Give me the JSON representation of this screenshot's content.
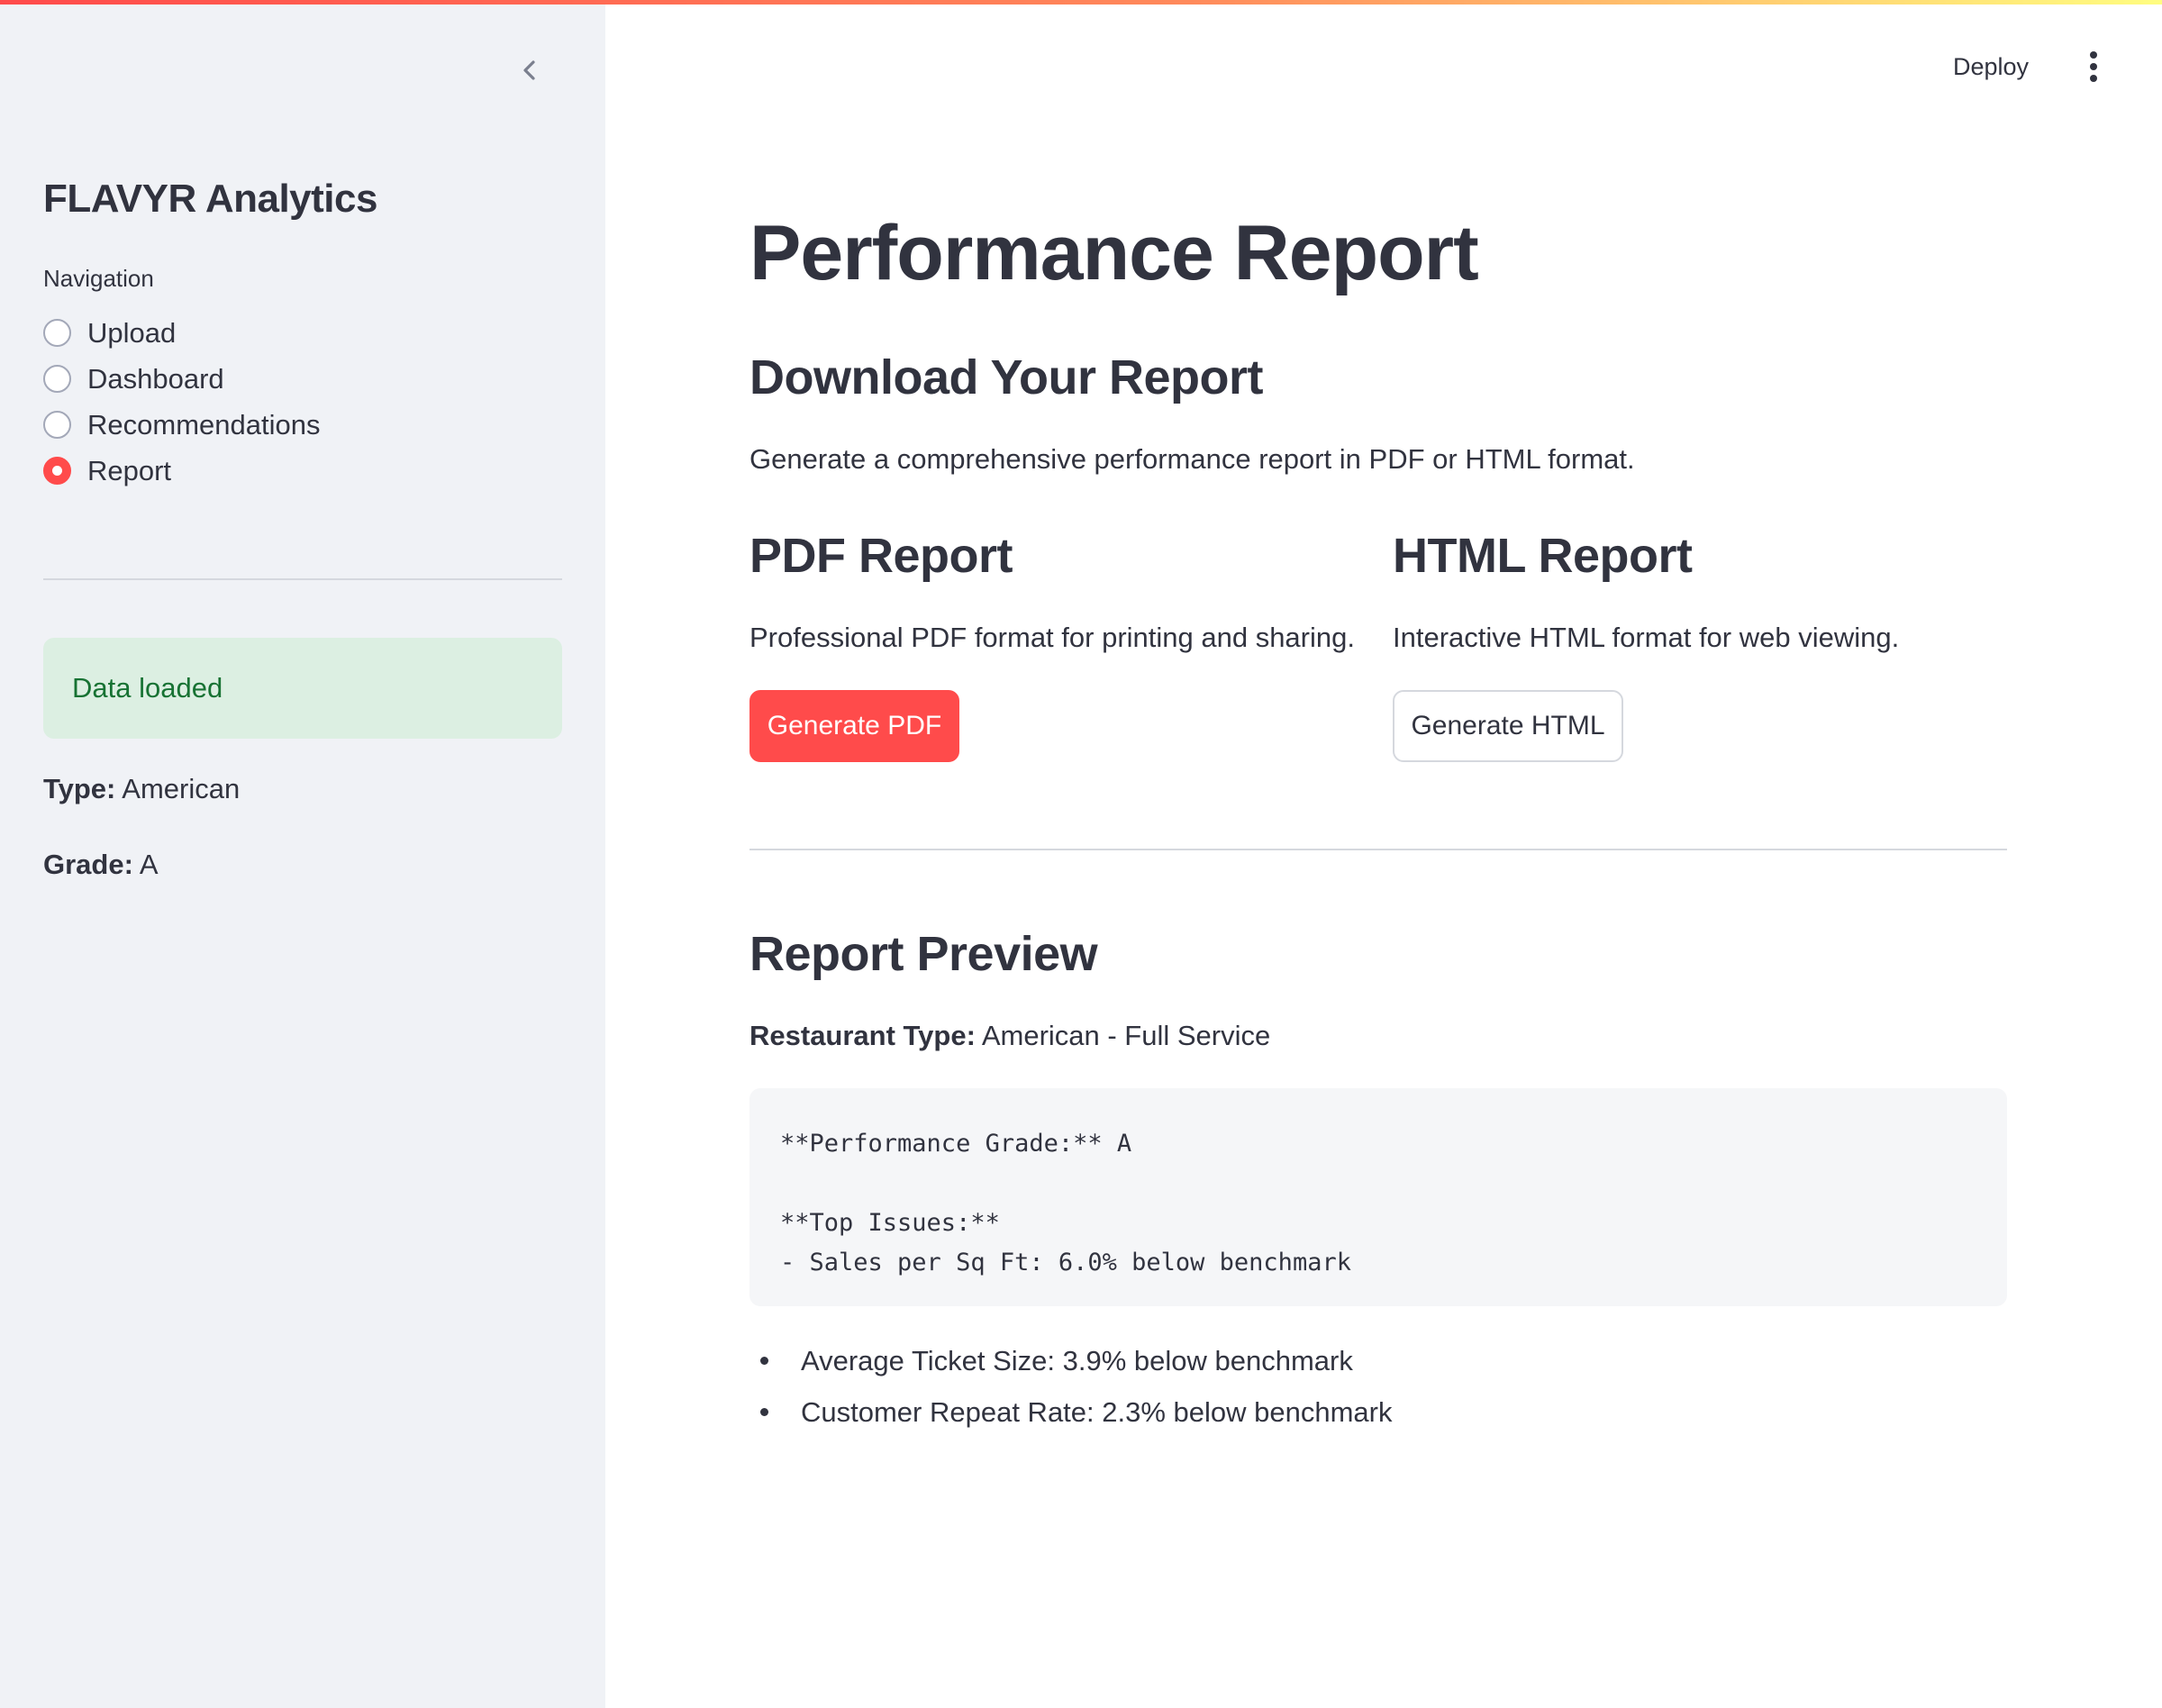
{
  "sidebar": {
    "app_title": "FLAVYR Analytics",
    "nav_label": "Navigation",
    "nav_items": [
      {
        "label": "Upload",
        "selected": false
      },
      {
        "label": "Dashboard",
        "selected": false
      },
      {
        "label": "Recommendations",
        "selected": false
      },
      {
        "label": "Report",
        "selected": true
      }
    ],
    "status_message": "Data loaded",
    "type_label": "Type:",
    "type_value": "American",
    "grade_label": "Grade:",
    "grade_value": "A"
  },
  "header": {
    "deploy_label": "Deploy",
    "menu_icon": "more-vertical-icon",
    "collapse_icon": "chevron-left-icon"
  },
  "main": {
    "page_title": "Performance Report",
    "download_heading": "Download Your Report",
    "download_desc": "Generate a comprehensive performance report in PDF or HTML format.",
    "pdf": {
      "heading": "PDF Report",
      "desc": "Professional PDF format for printing and sharing.",
      "button_label": "Generate PDF"
    },
    "html": {
      "heading": "HTML Report",
      "desc": "Interactive HTML format for web viewing.",
      "button_label": "Generate HTML"
    },
    "preview": {
      "heading": "Report Preview",
      "restaurant_label": "Restaurant Type:",
      "restaurant_value": "American - Full Service",
      "code_text": "**Performance Grade:** A\n\n**Top Issues:**\n- Sales per Sq Ft: 6.0% below benchmark",
      "bullets": [
        "Average Ticket Size: 3.9% below benchmark",
        "Customer Repeat Rate: 2.3% below benchmark"
      ]
    }
  },
  "colors": {
    "primary": "#ff4b4b",
    "sidebar_bg": "#f0f2f6",
    "success_bg": "#dcefe2",
    "success_text": "#177233",
    "text": "#31333f"
  }
}
